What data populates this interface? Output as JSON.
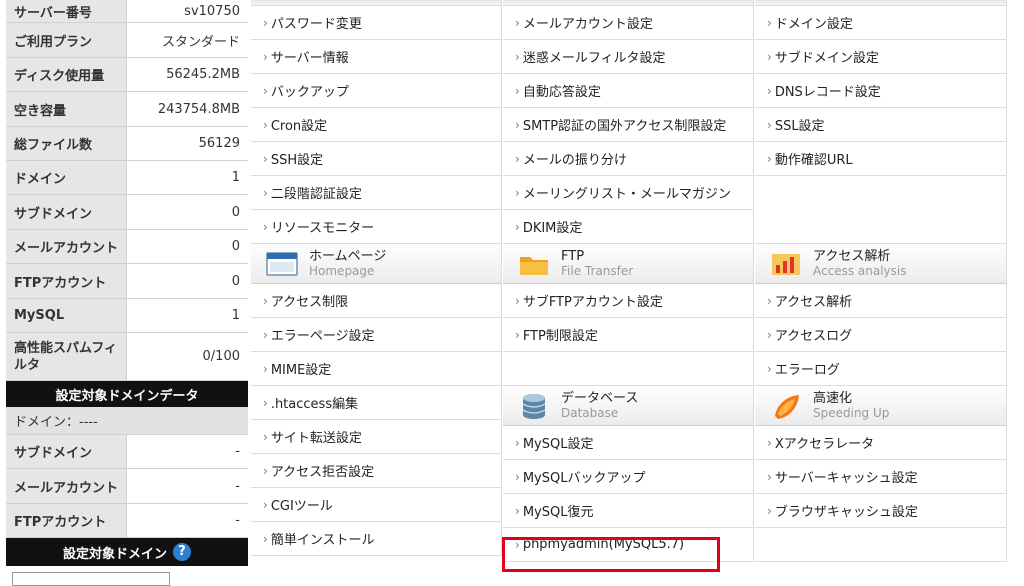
{
  "sidebar": {
    "server_info": [
      {
        "label": "サーバー番号",
        "value": "sv10750"
      },
      {
        "label": "ご利用プラン",
        "value": "スタンダード"
      },
      {
        "label": "ディスク使用量",
        "value": "56245.2MB"
      },
      {
        "label": "空き容量",
        "value": "243754.8MB"
      },
      {
        "label": "総ファイル数",
        "value": "56129"
      },
      {
        "label": "ドメイン",
        "value": "1"
      },
      {
        "label": "サブドメイン",
        "value": "0"
      },
      {
        "label": "メールアカウント",
        "value": "0"
      },
      {
        "label": "FTPアカウント",
        "value": "0"
      },
      {
        "label": "MySQL",
        "value": "1"
      },
      {
        "label": "高性能スパムフィルタ",
        "value": "0/100"
      }
    ],
    "domain_data_header": "設定対象ドメインデータ",
    "domain_line": "ドメイン：----",
    "domain_data": [
      {
        "label": "サブドメイン",
        "value": "-"
      },
      {
        "label": "メールアカウント",
        "value": "-"
      },
      {
        "label": "FTPアカウント",
        "value": "-"
      }
    ],
    "target_domain_header": "設定対象ドメイン",
    "help_icon": "?"
  },
  "grid": {
    "col1": {
      "items_top": [
        "パスワード変更",
        "サーバー情報",
        "バックアップ",
        "Cron設定",
        "SSH設定",
        "二段階認証設定",
        "リソースモニター"
      ],
      "section": {
        "jp": "ホームページ",
        "en": "Homepage",
        "icon": "window-icon"
      },
      "items_bottom": [
        "アクセス制限",
        "エラーページ設定",
        "MIME設定",
        ".htaccess編集",
        "サイト転送設定",
        "アクセス拒否設定",
        "CGIツール",
        "簡単インストール"
      ]
    },
    "col2": {
      "items_top": [
        "メールアカウント設定",
        "迷惑メールフィルタ設定",
        "自動応答設定",
        "SMTP認証の国外アクセス制限設定",
        "メールの振り分け",
        "メーリングリスト・メールマガジン",
        "DKIM設定"
      ],
      "section1": {
        "jp": "FTP",
        "en": "File Transfer",
        "icon": "folder-icon"
      },
      "items_mid": [
        "サブFTPアカウント設定",
        "FTP制限設定",
        ""
      ],
      "section2": {
        "jp": "データベース",
        "en": "Database",
        "icon": "database-icon"
      },
      "items_bottom": [
        "MySQL設定",
        "MySQLバックアップ",
        "MySQL復元",
        "phpmyadmin(MySQL5.7)"
      ]
    },
    "col3": {
      "items_top": [
        "ドメイン設定",
        "サブドメイン設定",
        "DNSレコード設定",
        "SSL設定",
        "動作確認URL",
        "",
        ""
      ],
      "section1": {
        "jp": "アクセス解析",
        "en": "Access analysis",
        "icon": "chart-icon"
      },
      "items_mid": [
        "アクセス解析",
        "アクセスログ",
        "エラーログ"
      ],
      "section2": {
        "jp": "高速化",
        "en": "Speeding Up",
        "icon": "rocket-icon"
      },
      "items_bottom": [
        "Xアクセラレータ",
        "サーバーキャッシュ設定",
        "ブラウザキャッシュ設定",
        ""
      ]
    }
  },
  "arrow_glyph": "›",
  "highlight_color": "#e1001a"
}
